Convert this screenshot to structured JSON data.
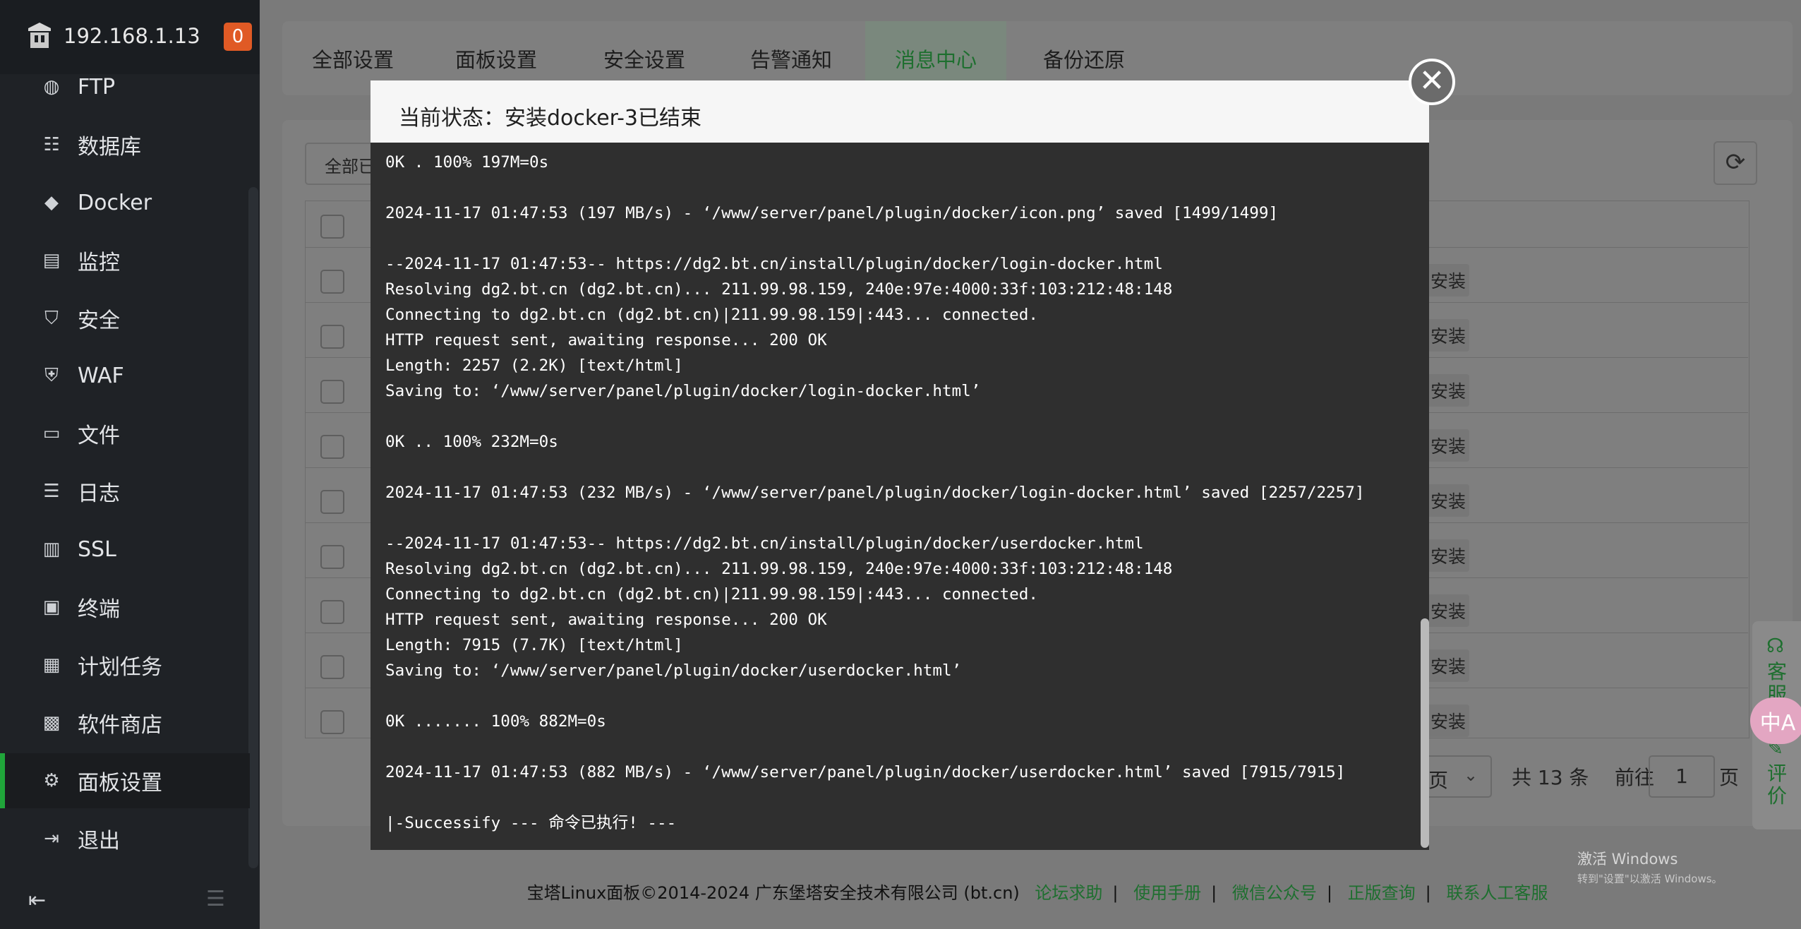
{
  "sidebar": {
    "server_ip": "192.168.1.13",
    "badge_count": "0",
    "items": [
      {
        "label": "FTP",
        "icon": "globe-icon"
      },
      {
        "label": "数据库",
        "icon": "database-icon"
      },
      {
        "label": "Docker",
        "icon": "docker-icon"
      },
      {
        "label": "监控",
        "icon": "monitor-icon"
      },
      {
        "label": "安全",
        "icon": "shield-icon"
      },
      {
        "label": "WAF",
        "icon": "waf-icon"
      },
      {
        "label": "文件",
        "icon": "folder-icon"
      },
      {
        "label": "日志",
        "icon": "log-icon"
      },
      {
        "label": "SSL",
        "icon": "ssl-icon"
      },
      {
        "label": "终端",
        "icon": "terminal-icon"
      },
      {
        "label": "计划任务",
        "icon": "calendar-icon"
      },
      {
        "label": "软件商店",
        "icon": "grid-icon"
      },
      {
        "label": "面板设置",
        "icon": "gear-icon"
      },
      {
        "label": "退出",
        "icon": "logout-icon"
      }
    ],
    "active_item": "面板设置"
  },
  "tabs": [
    "全部设置",
    "面板设置",
    "安全设置",
    "告警通知",
    "消息中心",
    "备份还原"
  ],
  "active_tab": "消息中心",
  "filter": {
    "select_text": "全部已"
  },
  "table": {
    "install_label": "安装"
  },
  "pagination": {
    "page_unit": "页",
    "total": "共 13 条",
    "goto_label": "前往",
    "goto_value": "1",
    "page_suffix": "页"
  },
  "modal": {
    "title": "当前状态：安装docker-3已结束",
    "log_lines": [
      "0K . 100% 197M=0s",
      "",
      "2024-11-17 01:47:53 (197 MB/s) - ‘/www/server/panel/plugin/docker/icon.png’ saved [1499/1499]",
      "",
      "--2024-11-17 01:47:53-- https://dg2.bt.cn/install/plugin/docker/login-docker.html",
      "Resolving dg2.bt.cn (dg2.bt.cn)... 211.99.98.159, 240e:97e:4000:33f:103:212:48:148",
      "Connecting to dg2.bt.cn (dg2.bt.cn)|211.99.98.159|:443... connected.",
      "HTTP request sent, awaiting response... 200 OK",
      "Length: 2257 (2.2K) [text/html]",
      "Saving to: ‘/www/server/panel/plugin/docker/login-docker.html’",
      "",
      "0K .. 100% 232M=0s",
      "",
      "2024-11-17 01:47:53 (232 MB/s) - ‘/www/server/panel/plugin/docker/login-docker.html’ saved [2257/2257]",
      "",
      "--2024-11-17 01:47:53-- https://dg2.bt.cn/install/plugin/docker/userdocker.html",
      "Resolving dg2.bt.cn (dg2.bt.cn)... 211.99.98.159, 240e:97e:4000:33f:103:212:48:148",
      "Connecting to dg2.bt.cn (dg2.bt.cn)|211.99.98.159|:443... connected.",
      "HTTP request sent, awaiting response... 200 OK",
      "Length: 7915 (7.7K) [text/html]",
      "Saving to: ‘/www/server/panel/plugin/docker/userdocker.html’",
      "",
      "0K ....... 100% 882M=0s",
      "",
      "2024-11-17 01:47:53 (882 MB/s) - ‘/www/server/panel/plugin/docker/userdocker.html’ saved [7915/7915]",
      "",
      "|-Successify --- 命令已执行! ---"
    ]
  },
  "footer": {
    "copyright": "宝塔Linux面板©2014-2024 广东堡塔安全技术有限公司 (bt.cn)",
    "links": [
      "论坛求助",
      "使用手册",
      "微信公众号",
      "正版查询",
      "联系人工客服"
    ]
  },
  "float_panel": {
    "support": "客服",
    "review": "评价",
    "translate": "中A"
  },
  "watermark": {
    "line1": "激活 Windows",
    "line2": "转到\"设置\"以激活 Windows。"
  }
}
